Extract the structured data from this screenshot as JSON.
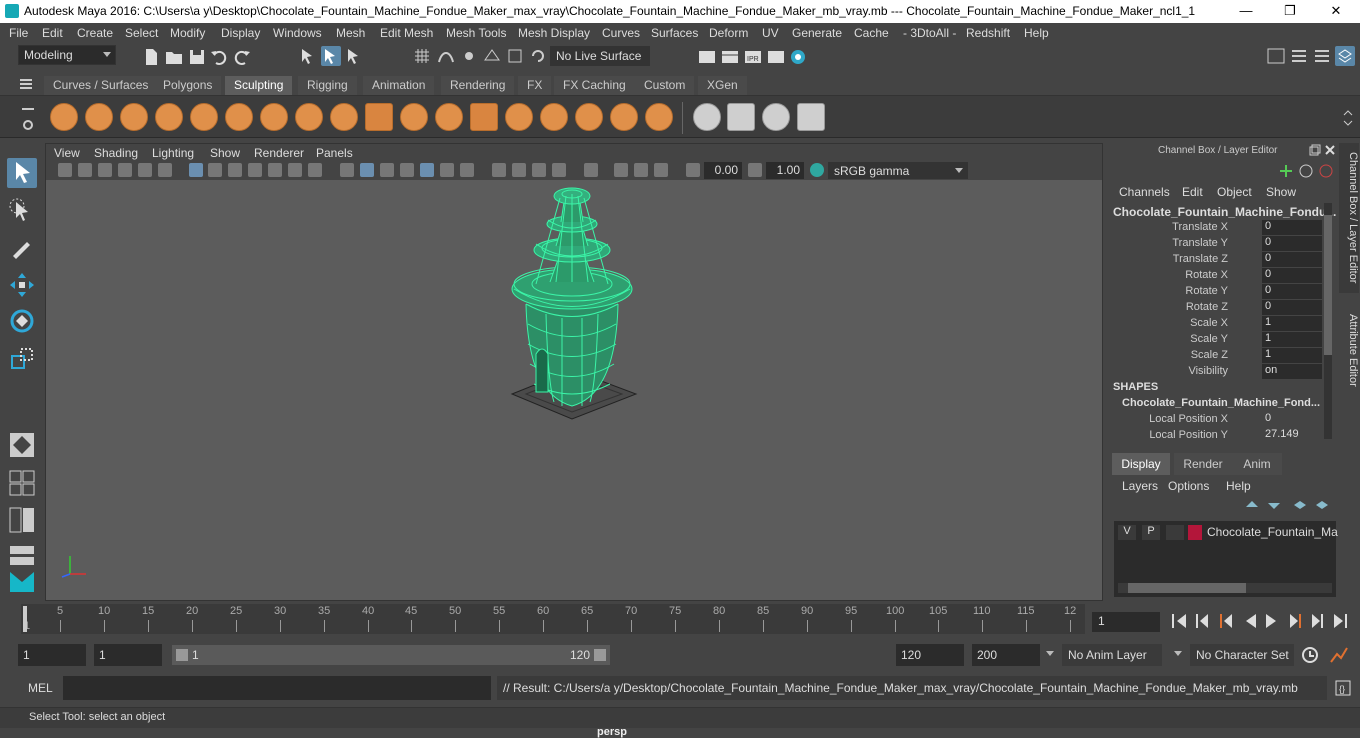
{
  "window": {
    "title": "Autodesk Maya 2016: C:\\Users\\a y\\Desktop\\Chocolate_Fountain_Machine_Fondue_Maker_max_vray\\Chocolate_Fountain_Machine_Fondue_Maker_mb_vray.mb   ---   Chocolate_Fountain_Machine_Fondue_Maker_ncl1_1",
    "controls": {
      "minimize": "—",
      "maximize": "❐",
      "close": "✕"
    }
  },
  "menu": [
    "File",
    "Edit",
    "Create",
    "Select",
    "Modify",
    "Display",
    "Windows",
    "Mesh",
    "Edit Mesh",
    "Mesh Tools",
    "Mesh Display",
    "Curves",
    "Surfaces",
    "Deform",
    "UV",
    "Generate",
    "Cache",
    "- 3DtoAll -",
    "Redshift",
    "Help"
  ],
  "status": {
    "mode": "Modeling",
    "live_surface": "No Live Surface"
  },
  "shelf_tabs": [
    "Curves / Surfaces",
    "Polygons",
    "Sculpting",
    "Rigging",
    "Animation",
    "Rendering",
    "FX",
    "FX Caching",
    "Custom",
    "XGen"
  ],
  "active_shelf_tab": "Sculpting",
  "viewport": {
    "menu": [
      "View",
      "Shading",
      "Lighting",
      "Show",
      "Renderer",
      "Panels"
    ],
    "exposure": "0.00",
    "gamma": "1.00",
    "color_space": "sRGB gamma",
    "camera": "persp"
  },
  "channel_box": {
    "header": "Channel Box / Layer Editor",
    "menu": [
      "Channels",
      "Edit",
      "Object",
      "Show"
    ],
    "object": "Chocolate_Fountain_Machine_Fondu...",
    "attributes": [
      {
        "label": "Translate X",
        "value": "0"
      },
      {
        "label": "Translate Y",
        "value": "0"
      },
      {
        "label": "Translate Z",
        "value": "0"
      },
      {
        "label": "Rotate X",
        "value": "0"
      },
      {
        "label": "Rotate Y",
        "value": "0"
      },
      {
        "label": "Rotate Z",
        "value": "0"
      },
      {
        "label": "Scale X",
        "value": "1"
      },
      {
        "label": "Scale Y",
        "value": "1"
      },
      {
        "label": "Scale Z",
        "value": "1"
      },
      {
        "label": "Visibility",
        "value": "on"
      }
    ],
    "shapes_label": "SHAPES",
    "shape_name": "Chocolate_Fountain_Machine_Fond...",
    "shape_attributes": [
      {
        "label": "Local Position X",
        "value": "0"
      },
      {
        "label": "Local Position Y",
        "value": "27.149"
      }
    ]
  },
  "side_tabs": {
    "channel_box": "Channel Box / Layer Editor",
    "attribute_editor": "Attribute Editor"
  },
  "layer_editor": {
    "tabs": [
      "Display",
      "Render",
      "Anim"
    ],
    "active_tab": "Display",
    "menu": [
      "Layers",
      "Options",
      "Help"
    ],
    "layer": {
      "v": "V",
      "p": "P",
      "name": "Chocolate_Fountain_Ma",
      "color": "#b3163a"
    }
  },
  "timeline": {
    "ticks": [
      "5",
      "10",
      "15",
      "20",
      "25",
      "30",
      "35",
      "40",
      "45",
      "50",
      "55",
      "60",
      "65",
      "70",
      "75",
      "80",
      "85",
      "90",
      "95",
      "100",
      "105",
      "110",
      "115",
      "12"
    ],
    "start_label": "1",
    "current_frame": "1"
  },
  "range": {
    "start": "1",
    "playback_start": "1",
    "slider_start": "1",
    "slider_end": "120",
    "playback_end": "120",
    "end": "200",
    "anim_layer": "No Anim Layer",
    "character_set": "No Character Set"
  },
  "command_line": {
    "label": "MEL",
    "result": "// Result: C:/Users/a y/Desktop/Chocolate_Fountain_Machine_Fondue_Maker_max_vray/Chocolate_Fountain_Machine_Fondue_Maker_mb_vray.mb"
  },
  "help_line": "Select Tool: select an object",
  "colors": {
    "wireframe": "#3bf5a8",
    "shelf_orange": "#e0904a",
    "layer_swatch": "#b3163a"
  }
}
